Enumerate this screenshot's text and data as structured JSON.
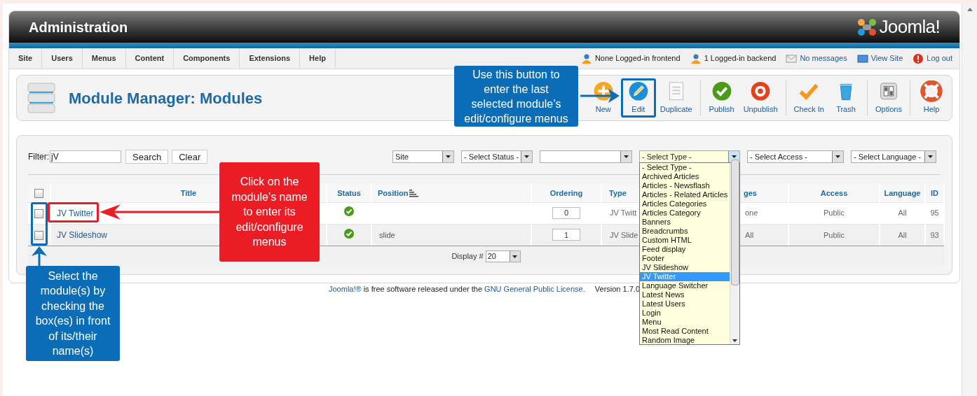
{
  "header": {
    "title": "Administration",
    "logo_text": "Joomla!"
  },
  "menu": [
    "Site",
    "Users",
    "Menus",
    "Content",
    "Components",
    "Extensions",
    "Help"
  ],
  "status_links": [
    {
      "label": "None Logged-in frontend",
      "kind": "user"
    },
    {
      "label": "1 Logged-in backend",
      "kind": "user"
    },
    {
      "label": "No messages",
      "kind": "mail"
    },
    {
      "label": "View Site",
      "kind": "screen"
    },
    {
      "label": "Log out",
      "kind": "logout"
    }
  ],
  "page_title": "Module Manager: Modules",
  "toolbar": [
    {
      "label": "New",
      "kind": "new",
      "separator_after": false
    },
    {
      "label": "Edit",
      "kind": "edit",
      "separator_after": false
    },
    {
      "label": "Duplicate",
      "kind": "duplicate",
      "separator_after": true
    },
    {
      "label": "Publish",
      "kind": "publish",
      "separator_after": false
    },
    {
      "label": "Unpublish",
      "kind": "unpublish",
      "separator_after": true
    },
    {
      "label": "Check In",
      "kind": "checkin",
      "separator_after": false
    },
    {
      "label": "Trash",
      "kind": "trash",
      "separator_after": true
    },
    {
      "label": "Options",
      "kind": "options",
      "separator_after": true
    },
    {
      "label": "Help",
      "kind": "help",
      "separator_after": false
    }
  ],
  "filter": {
    "label": "Filter:",
    "value": "jV",
    "buttons": [
      "Search",
      "Clear"
    ]
  },
  "selects": [
    {
      "value": "Site",
      "open": false
    },
    {
      "value": "- Select Status -",
      "open": false
    },
    {
      "open": false
    },
    {
      "value": "- Select Type -",
      "open": true
    },
    {
      "value": "- Select Access -",
      "open": false
    },
    {
      "value": "- Select Language -",
      "open": false
    }
  ],
  "type_options": [
    {
      "label": "- Select Type -",
      "selected": false
    },
    {
      "label": "Archived Articles",
      "selected": false
    },
    {
      "label": "Articles - Newsflash",
      "selected": false
    },
    {
      "label": "Articles - Related Articles",
      "selected": false
    },
    {
      "label": "Articles Categories",
      "selected": false
    },
    {
      "label": "Articles Category",
      "selected": false
    },
    {
      "label": "Banners",
      "selected": false
    },
    {
      "label": "Breadcrumbs",
      "selected": false
    },
    {
      "label": "Custom HTML",
      "selected": false
    },
    {
      "label": "Feed display",
      "selected": false
    },
    {
      "label": "Footer",
      "selected": false
    },
    {
      "label": "JV Slideshow",
      "selected": false
    },
    {
      "label": "JV Twitter",
      "selected": true
    },
    {
      "label": "Language Switcher",
      "selected": false
    },
    {
      "label": "Latest News",
      "selected": false
    },
    {
      "label": "Latest Users",
      "selected": false
    },
    {
      "label": "Login",
      "selected": false
    },
    {
      "label": "Menu",
      "selected": false
    },
    {
      "label": "Most Read Content",
      "selected": false
    },
    {
      "label": "Random Image",
      "selected": false
    }
  ],
  "table": {
    "select_all_checked": false,
    "columns": [
      "Title",
      "Status",
      "Position",
      "Ordering",
      "Type",
      "ges",
      "Access",
      "Language",
      "ID"
    ],
    "rows": [
      {
        "checked": false,
        "title": "JV Twitter",
        "published": true,
        "ordering": "0",
        "type": "JV Twitt",
        "pages": "one",
        "access": "Public",
        "language": "All",
        "id": "95"
      },
      {
        "checked": false,
        "title": "JV Slideshow",
        "published": true,
        "position": "slide",
        "ordering": "1",
        "type": "JV Slide",
        "pages": "All",
        "access": "Public",
        "language": "All",
        "id": "93"
      }
    ]
  },
  "pagination": {
    "label": "Display #",
    "value": "20"
  },
  "footer": {
    "parts": [
      {
        "text": "Joomla!®",
        "link": true
      },
      {
        "text": " is free software released under the ",
        "link": false
      },
      {
        "text": "GNU General Public License.",
        "link": true
      }
    ],
    "version": "Version 1.7.0"
  },
  "annotations": [
    {
      "text": "Use this button to enter the last selected module’s edit/configure menus",
      "color": "#0b6db7"
    },
    {
      "text": "Click on the module’s name to enter its edit/configure menus",
      "color": "#ec1c24"
    },
    {
      "text": "Select the module(s) by checking the box(es) in front of its/their name(s)",
      "color": "#0b6db7"
    }
  ]
}
